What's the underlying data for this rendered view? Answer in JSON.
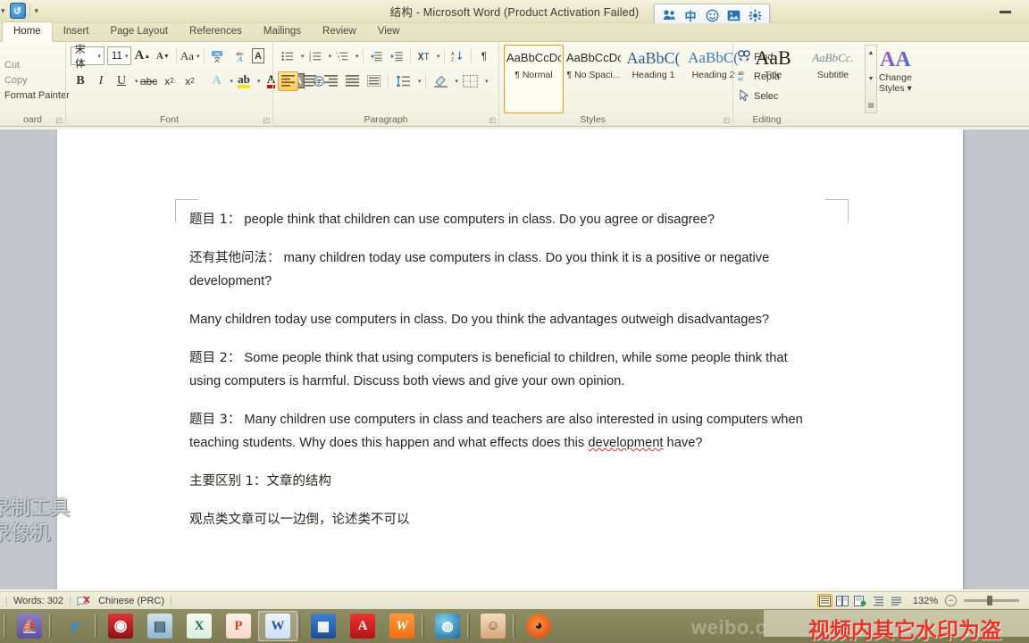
{
  "window": {
    "doc_name": "结构",
    "title_suffix": " - Microsoft Word (Product Activation Failed)",
    "minimize_label": "Minimize"
  },
  "quick_access": {
    "caret_label": "▾",
    "undo_label": "↺",
    "dropdown_label": "▾"
  },
  "ime_bar": {
    "items": [
      {
        "name": "ime-logo-icon",
        "glyph": "❀"
      },
      {
        "name": "ime-chinese-mode-icon",
        "glyph": "中"
      },
      {
        "name": "ime-emoji-icon",
        "glyph": "☺"
      },
      {
        "name": "ime-picture-icon",
        "glyph": "▣"
      },
      {
        "name": "ime-settings-icon",
        "glyph": "✿"
      }
    ]
  },
  "ribbon": {
    "tabs": [
      {
        "label": "Home",
        "active": true
      },
      {
        "label": "Insert",
        "active": false
      },
      {
        "label": "Page Layout",
        "active": false
      },
      {
        "label": "References",
        "active": false
      },
      {
        "label": "Mailings",
        "active": false
      },
      {
        "label": "Review",
        "active": false
      },
      {
        "label": "View",
        "active": false
      }
    ],
    "clipboard": {
      "label": "oard",
      "cut": "Cut",
      "copy": "Copy",
      "format_painter": "Format Painter",
      "launcher": "◰"
    },
    "font": {
      "label": "Font",
      "font_name": "宋体",
      "font_size": "11",
      "grow_font": "A",
      "shrink_font": "A",
      "change_case": "Aa",
      "phonetic_guide": "文",
      "character_border": "A",
      "clear_formatting": "A",
      "bold": "B",
      "italic": "I",
      "underline": "U",
      "strikethrough": "abc",
      "subscript": "x",
      "superscript": "x",
      "text_effects": "A",
      "highlight": "ab",
      "font_color": "A",
      "character_shading": "A",
      "enclose_characters": "A",
      "launcher": "◰"
    },
    "paragraph": {
      "label": "Paragraph",
      "bullets": "•",
      "numbering": "1",
      "multilevel": "⅓",
      "decrease_indent": "◄",
      "increase_indent": "►",
      "asian_layout": "父",
      "sort": "A↓",
      "show_marks": "¶",
      "align_left": "▤",
      "align_center": "▤",
      "align_right": "▤",
      "justify": "▤",
      "distributed": "▤",
      "line_spacing": "↕",
      "shading": "◇",
      "borders": "⊞",
      "launcher": "◰"
    },
    "styles": {
      "label": "Styles",
      "launcher": "◰",
      "gallery": [
        {
          "preview": "AaBbCcDc",
          "name": "¶ Normal",
          "selected": true,
          "kind": "normal"
        },
        {
          "preview": "AaBbCcDc",
          "name": "¶ No Spaci...",
          "selected": false,
          "kind": "normal"
        },
        {
          "preview": "AaBbC(",
          "name": "Heading 1",
          "selected": false,
          "kind": "h1"
        },
        {
          "preview": "AaBbC(",
          "name": "Heading 2",
          "selected": false,
          "kind": "h2"
        },
        {
          "preview": "AaB",
          "name": "Title",
          "selected": false,
          "kind": "title"
        },
        {
          "preview": "AaBbCc.",
          "name": "Subtitle",
          "selected": false,
          "kind": "subtitle"
        }
      ],
      "scroll_up": "▲",
      "scroll_down": "▼",
      "scroll_more": "▤",
      "change_styles": "Change\nStyles ▾",
      "change_styles_line1": "Change",
      "change_styles_line2": "Styles ▾"
    },
    "editing": {
      "label": "Editing",
      "find": "Find",
      "replace": "Repla",
      "select": "Selec",
      "find_icon": "🔍",
      "replace_icon": "ab",
      "select_icon": "↖"
    }
  },
  "document": {
    "paragraphs": [
      {
        "id": "p1",
        "zh": "题目 1：",
        "en": "  people think that children can use computers in class. Do you agree or disagree?"
      },
      {
        "id": "p2",
        "zh": "还有其他问法：",
        "en": "  many children today use computers in class. Do you think it is a positive or negative development?"
      },
      {
        "id": "p3",
        "zh": "",
        "en": "Many children today use computers in class. Do you think the advantages outweigh disadvantages?"
      },
      {
        "id": "p4",
        "zh": "题目 2：",
        "en": " Some people think that using computers is beneficial to children, while some people think that using computers is harmful. Discuss both views and give your own opinion."
      },
      {
        "id": "p5",
        "zh": "题目 3：",
        "en": " Many children use computers in class and teachers are also interested in using computers when teaching students. Why does this happen and what effects does this ",
        "en_squiggle": "development",
        "en_tail": " have?"
      },
      {
        "id": "p6",
        "zh": "主要区别 1：文章的结构",
        "en": ""
      },
      {
        "id": "p7",
        "zh": "观点类文章可以一边倒，论述类不可以",
        "en": ""
      }
    ]
  },
  "status_bar": {
    "words": "Words: 302",
    "language": "Chinese (PRC)",
    "proofing_icon": "spell-check-icon",
    "zoom_level": "132%",
    "zoom_out": "−",
    "view_buttons": [
      {
        "name": "print-layout-view",
        "glyph": "▤",
        "active": true
      },
      {
        "name": "full-screen-reading-view",
        "glyph": "▥",
        "active": false
      },
      {
        "name": "web-layout-view",
        "glyph": "▦",
        "active": false
      },
      {
        "name": "outline-view",
        "glyph": "▧",
        "active": false
      },
      {
        "name": "draft-view",
        "glyph": "▨",
        "active": false
      }
    ]
  },
  "taskbar": {
    "items": [
      {
        "name": "taskbar-item-ship",
        "glyph": "⛵",
        "color": "#6b5ca8",
        "active": false
      },
      {
        "name": "taskbar-item-internet-explorer",
        "glyph": "e",
        "color": "#3b8fd4",
        "active": false
      },
      {
        "name": "taskbar-item-red-circle-app",
        "glyph": "◉",
        "color": "#b01f24",
        "active": false
      },
      {
        "name": "taskbar-item-notes",
        "glyph": "▤",
        "color": "#9fc5d8",
        "active": false
      },
      {
        "name": "taskbar-item-excel",
        "glyph": "X",
        "color": "#1d7044",
        "active": false
      },
      {
        "name": "taskbar-item-powerpoint",
        "glyph": "P",
        "color": "#d04423",
        "active": false
      },
      {
        "name": "taskbar-item-word",
        "glyph": "W",
        "color": "#2b579a",
        "active": true
      },
      {
        "name": "taskbar-item-media",
        "glyph": "▦",
        "color": "#2a5fa8",
        "active": false
      },
      {
        "name": "taskbar-item-acrobat",
        "glyph": "A",
        "color": "#cc2229",
        "active": false
      },
      {
        "name": "taskbar-item-wps",
        "glyph": "W",
        "color": "#f08022",
        "active": false
      },
      {
        "name": "taskbar-item-browser-globe",
        "glyph": "◍",
        "color": "#2e8ab5",
        "active": false
      },
      {
        "name": "taskbar-item-avatar-app",
        "glyph": "☺",
        "color": "#e0b08a",
        "active": false
      },
      {
        "name": "taskbar-item-cat-app",
        "glyph": "◕",
        "color": "#e8651f",
        "active": false
      }
    ]
  },
  "watermarks": {
    "left_line1": "录制工具",
    "left_line2": "录像机",
    "weibo": "weibo.c",
    "red_notice": "视频内其它水印为盗"
  }
}
